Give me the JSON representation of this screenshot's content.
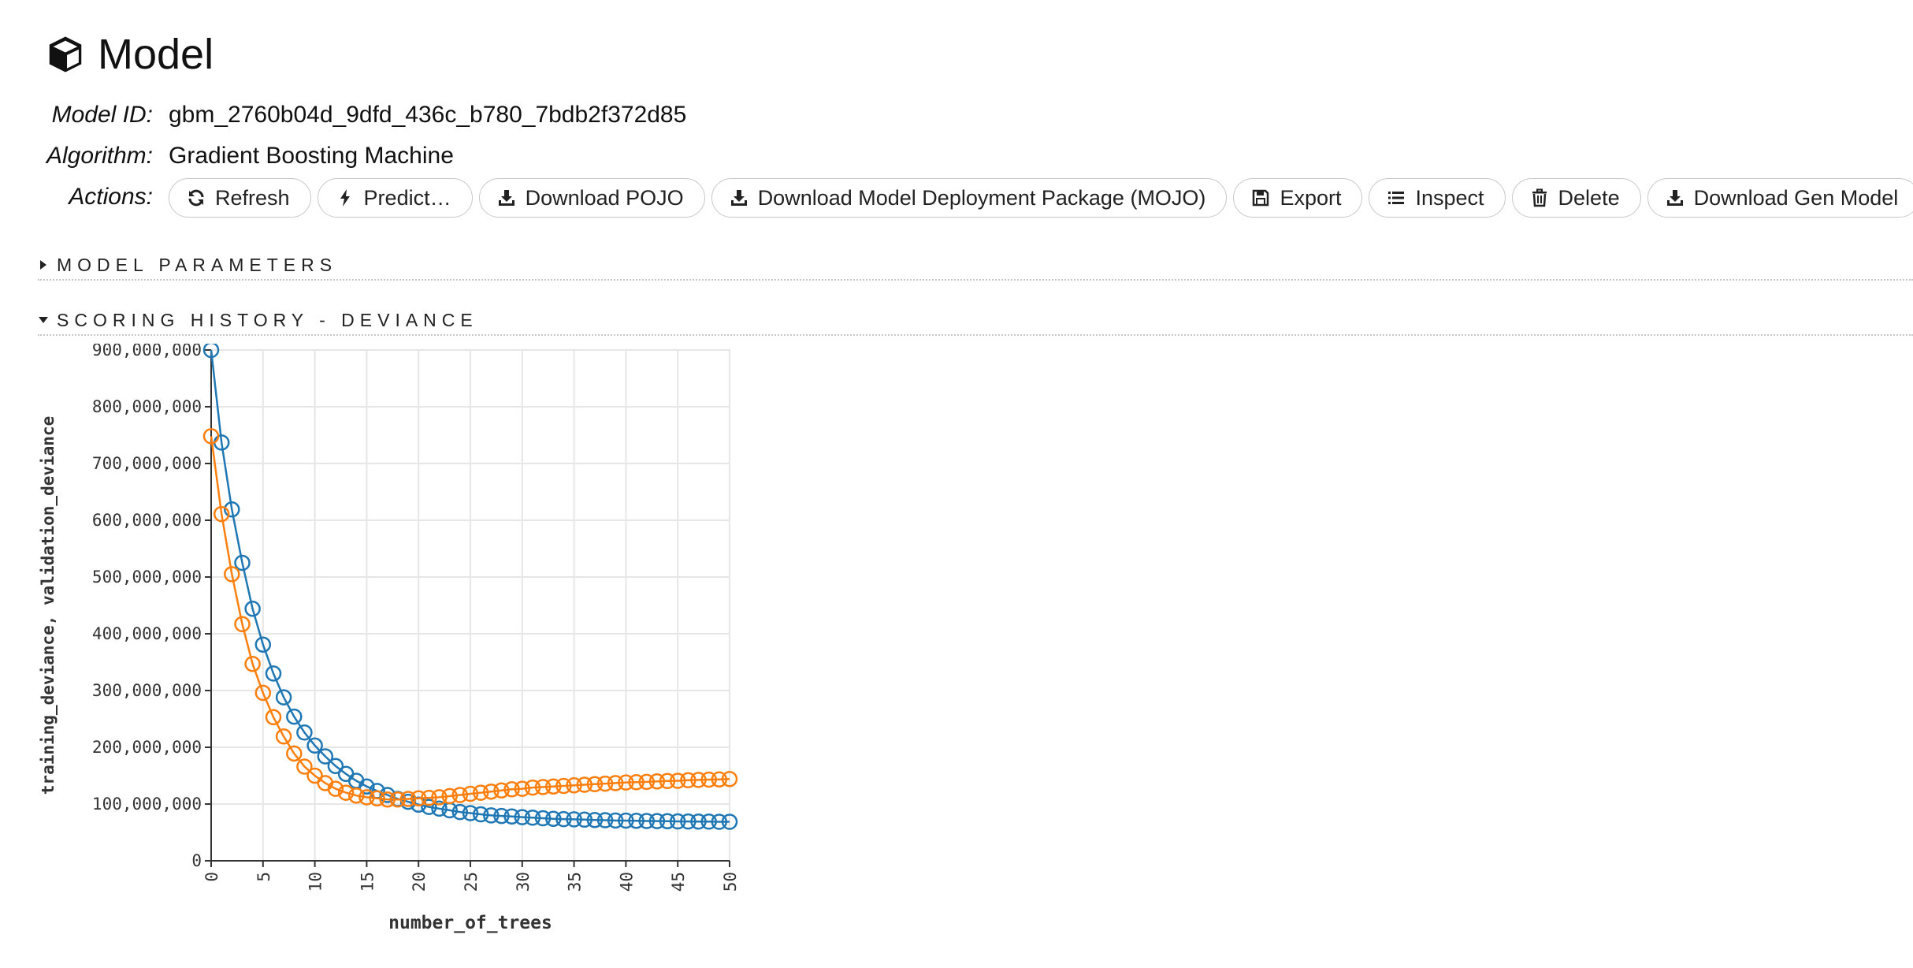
{
  "header": {
    "title": "Model",
    "icon": "cube-icon"
  },
  "model_id": {
    "label": "Model ID:",
    "value": "gbm_2760b04d_9dfd_436c_b780_7bdb2f372d85"
  },
  "algorithm": {
    "label": "Algorithm:",
    "value": "Gradient Boosting Machine"
  },
  "actions": {
    "label": "Actions:",
    "buttons": [
      {
        "label": "Refresh",
        "icon": "refresh-icon"
      },
      {
        "label": "Predict…",
        "icon": "bolt-icon"
      },
      {
        "label": "Download POJO",
        "icon": "download-icon"
      },
      {
        "label": "Download Model Deployment Package (MOJO)",
        "icon": "download-icon"
      },
      {
        "label": "Export",
        "icon": "save-icon"
      },
      {
        "label": "Inspect",
        "icon": "list-icon"
      },
      {
        "label": "Delete",
        "icon": "trash-icon"
      },
      {
        "label": "Download Gen Model",
        "icon": "download-icon"
      }
    ]
  },
  "sections": {
    "model_parameters": {
      "label": "MODEL PARAMETERS",
      "expanded": false
    },
    "scoring_history": {
      "label": "SCORING HISTORY - DEVIANCE",
      "expanded": true
    }
  },
  "colors": {
    "training": "#1f77b4",
    "validation": "#ff7f0e",
    "grid": "#e6e6e6"
  },
  "chart_data": {
    "type": "line",
    "title": "",
    "xlabel": "number_of_trees",
    "ylabel": "training_deviance, validation_deviance",
    "xlim": [
      0,
      50
    ],
    "ylim": [
      0,
      900000000
    ],
    "x_ticks": [
      0,
      5,
      10,
      15,
      20,
      25,
      30,
      35,
      40,
      45,
      50
    ],
    "y_ticks": [
      0,
      100000000,
      200000000,
      300000000,
      400000000,
      500000000,
      600000000,
      700000000,
      800000000,
      900000000
    ],
    "y_tick_labels": [
      "0",
      "100,000,000",
      "200,000,000",
      "300,000,000",
      "400,000,000",
      "500,000,000",
      "600,000,000",
      "700,000,000",
      "800,000,000",
      "900,000,000"
    ],
    "grid": true,
    "markers": "open-circle",
    "x": [
      0,
      1,
      2,
      3,
      4,
      5,
      6,
      7,
      8,
      9,
      10,
      11,
      12,
      13,
      14,
      15,
      16,
      17,
      18,
      19,
      20,
      21,
      22,
      23,
      24,
      25,
      26,
      27,
      28,
      29,
      30,
      31,
      32,
      33,
      34,
      35,
      36,
      37,
      38,
      39,
      40,
      41,
      42,
      43,
      44,
      45,
      46,
      47,
      48,
      49,
      50
    ],
    "series": [
      {
        "key": "training",
        "values": [
          900000000,
          737000000,
          619000000,
          525000000,
          444000000,
          381000000,
          330000000,
          288000000,
          254000000,
          226000000,
          203000000,
          184000000,
          167000000,
          153000000,
          141000000,
          131000000,
          123000000,
          116000000,
          109000000,
          104000000,
          99000000,
          95000000,
          92000000,
          89000000,
          86000000,
          84000000,
          82000000,
          80000000,
          79000000,
          78000000,
          77000000,
          76000000,
          75000000,
          74000000,
          73500000,
          73000000,
          72500000,
          72000000,
          71500000,
          71000000,
          70800000,
          70500000,
          70200000,
          70000000,
          69800000,
          69500000,
          69300000,
          69100000,
          69000000,
          68800000,
          68700000
        ]
      },
      {
        "key": "validation",
        "values": [
          748000000,
          611000000,
          505000000,
          417000000,
          347000000,
          296000000,
          253000000,
          219000000,
          189000000,
          166000000,
          150000000,
          137000000,
          127000000,
          120000000,
          115000000,
          112000000,
          110000000,
          108000000,
          108000000,
          109000000,
          110000000,
          111000000,
          112000000,
          114000000,
          116000000,
          118000000,
          120000000,
          122000000,
          124000000,
          126000000,
          127000000,
          129000000,
          130000000,
          131000000,
          132000000,
          133000000,
          134000000,
          135000000,
          136000000,
          137000000,
          138000000,
          138500000,
          139000000,
          140000000,
          140500000,
          141000000,
          142000000,
          142500000,
          143000000,
          143500000,
          144000000
        ]
      }
    ]
  }
}
